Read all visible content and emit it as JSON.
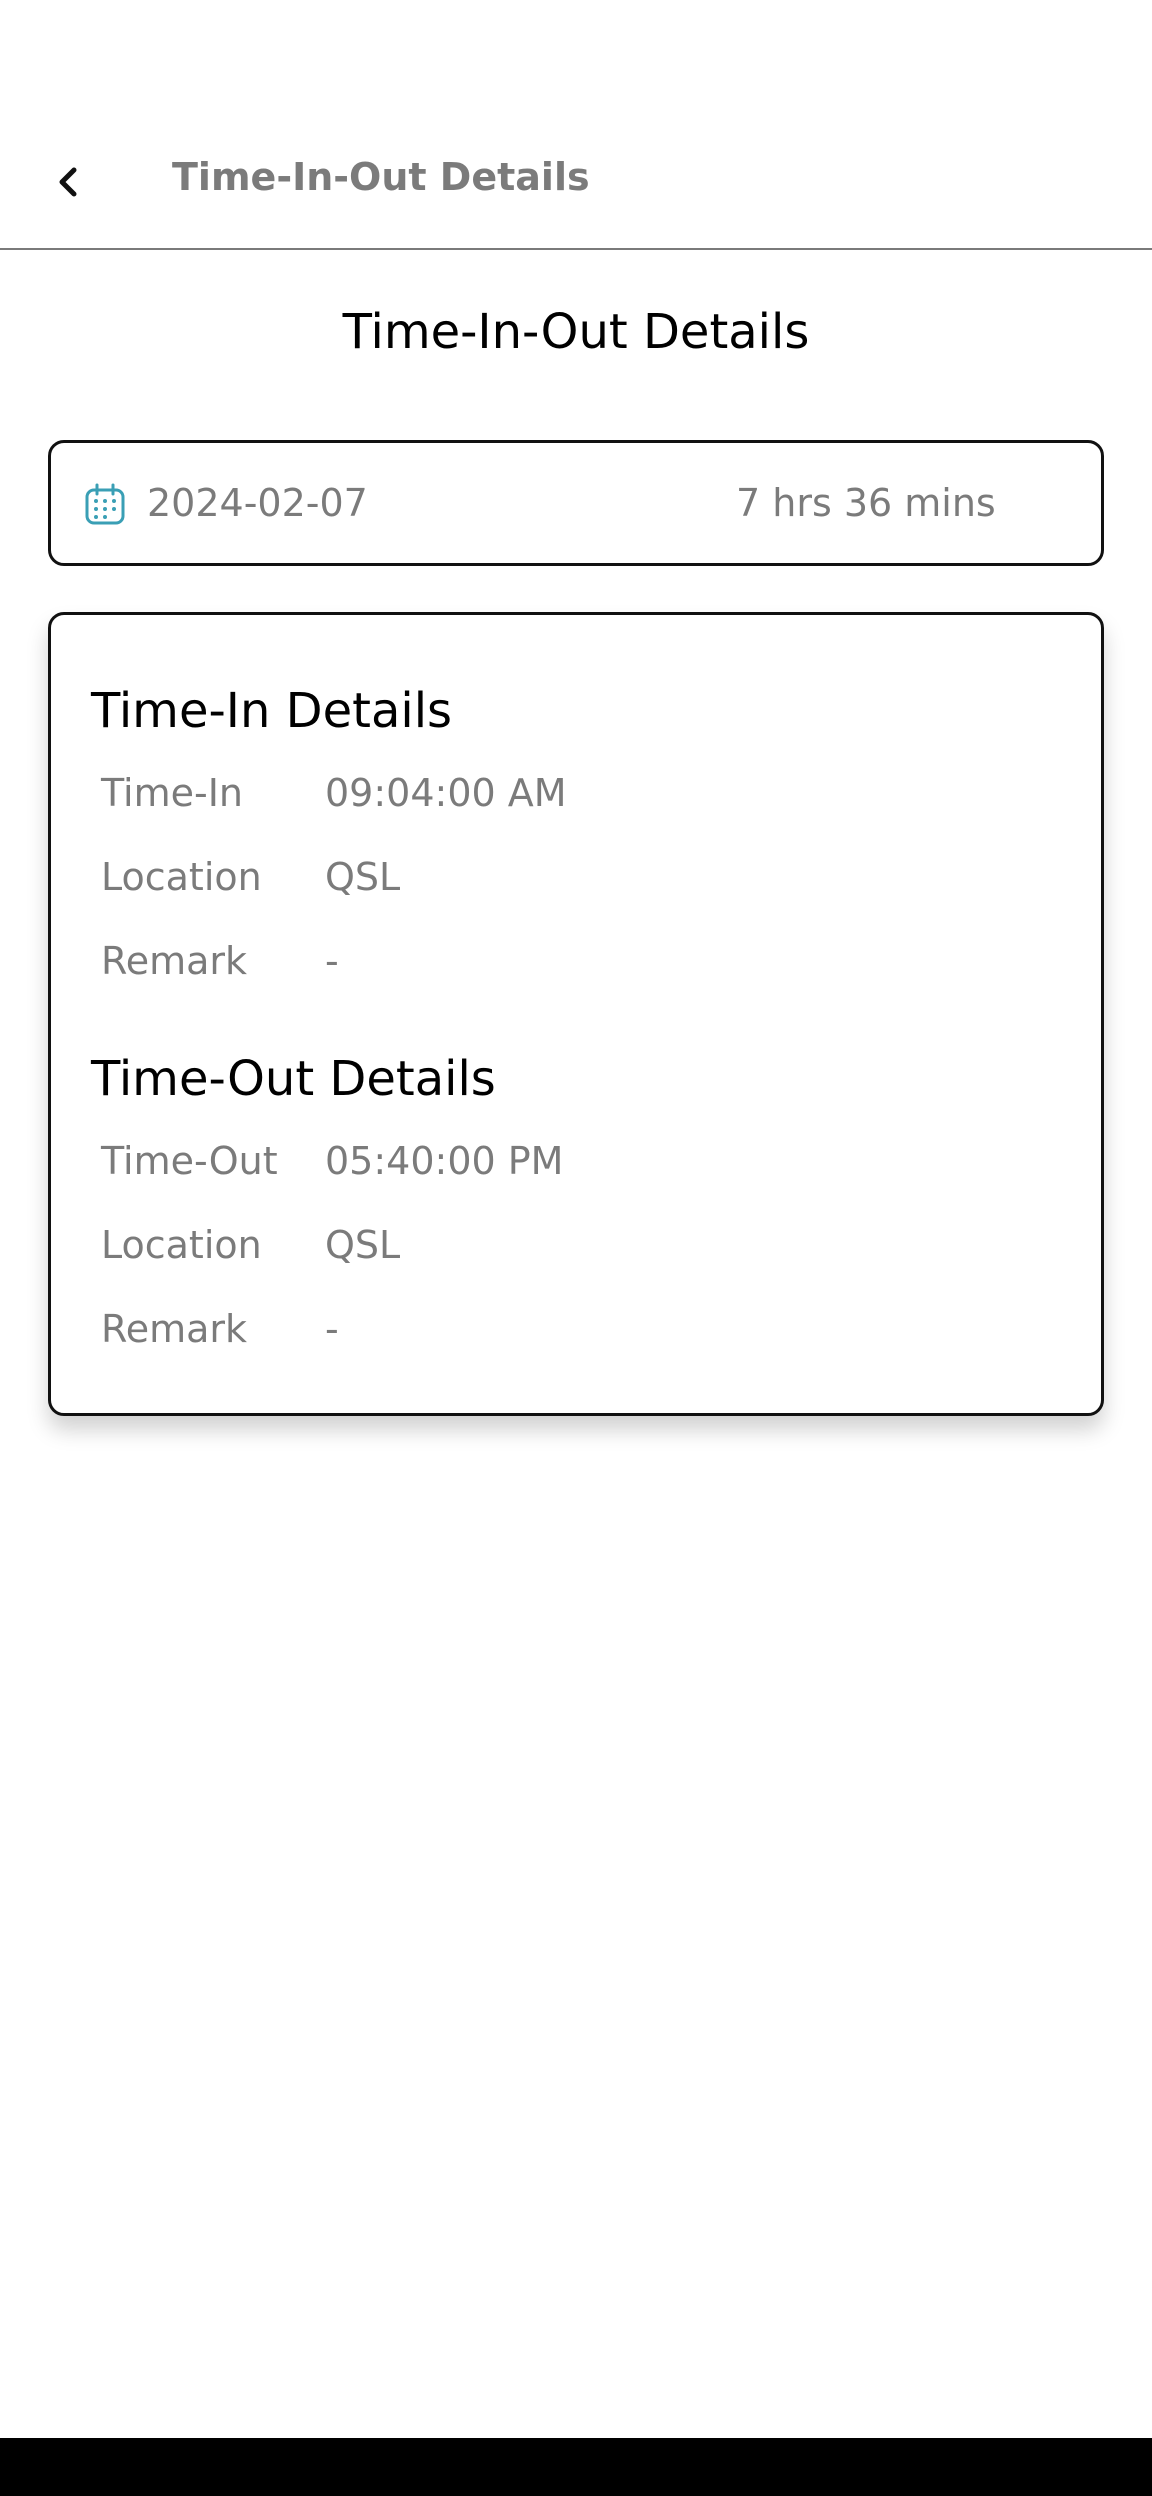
{
  "appbar": {
    "title": "Time-In-Out Details",
    "back_icon": "chevron-left-icon"
  },
  "page": {
    "title": "Time-In-Out Details"
  },
  "summary": {
    "date_icon": "calendar-icon",
    "date": "2024-02-07",
    "duration": "7 hrs 36 mins",
    "accent_color": "#3a9fb5"
  },
  "time_in": {
    "heading": "Time-In Details",
    "rows": [
      {
        "label": "Time-In",
        "value": "09:04:00 AM"
      },
      {
        "label": "Location",
        "value": "QSL"
      },
      {
        "label": "Remark",
        "value": "-"
      }
    ]
  },
  "time_out": {
    "heading": "Time-Out Details",
    "rows": [
      {
        "label": "Time-Out",
        "value": "05:40:00 PM"
      },
      {
        "label": "Location",
        "value": "QSL"
      },
      {
        "label": "Remark",
        "value": "-"
      }
    ]
  }
}
